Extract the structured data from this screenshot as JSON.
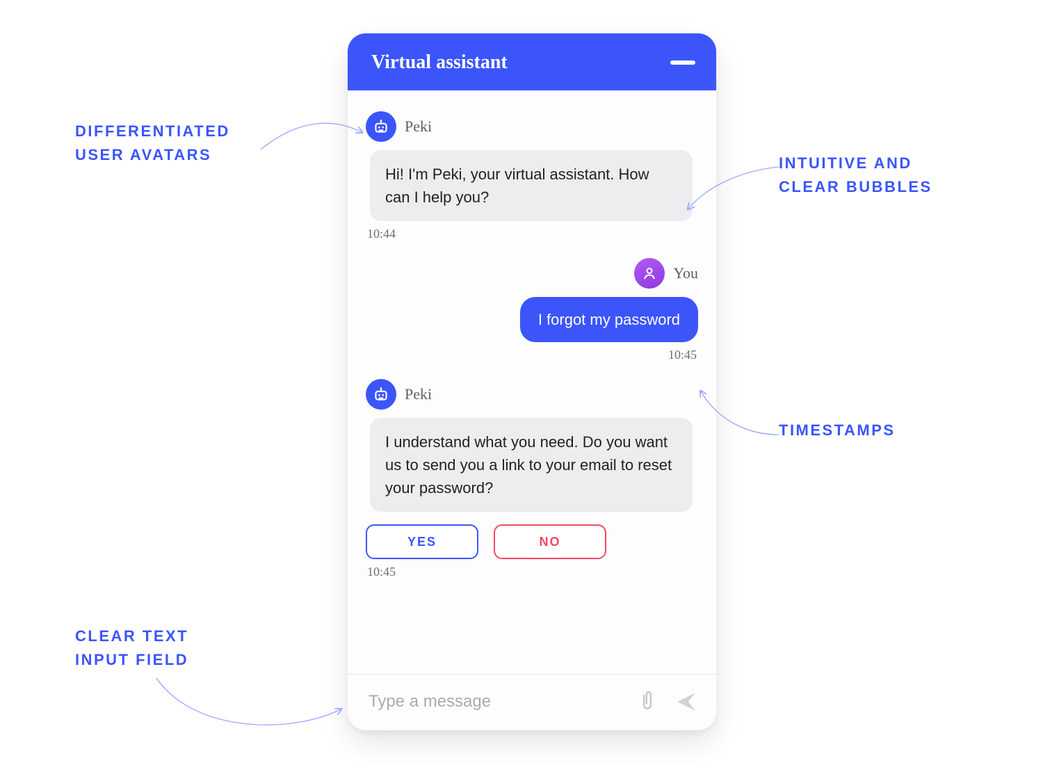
{
  "header": {
    "title": "Virtual assistant"
  },
  "senders": {
    "bot": "Peki",
    "user": "You"
  },
  "messages": {
    "m1": {
      "text": "Hi! I'm Peki, your virtual assistant. How can I help you?",
      "time": "10:44"
    },
    "m2": {
      "text": "I forgot my password",
      "time": "10:45"
    },
    "m3": {
      "text": "I understand what you need. Do you want us to send you a link to your email to reset your password?",
      "time": "10:45"
    }
  },
  "actions": {
    "yes": "YES",
    "no": "NO"
  },
  "input": {
    "placeholder": "Type a message"
  },
  "callouts": {
    "avatars_line1": "DIFFERENTIATED",
    "avatars_line2": "USER AVATARS",
    "bubbles_line1": "INTUITIVE AND",
    "bubbles_line2": "CLEAR BUBBLES",
    "timestamps": "TIMESTAMPS",
    "input_line1": "CLEAR TEXT",
    "input_line2": "INPUT FIELD"
  },
  "colors": {
    "primary": "#3B55FA",
    "user_avatar": "#A84CDB",
    "bot_bubble_bg": "#EDEDF0",
    "no_button": "#F54664"
  }
}
